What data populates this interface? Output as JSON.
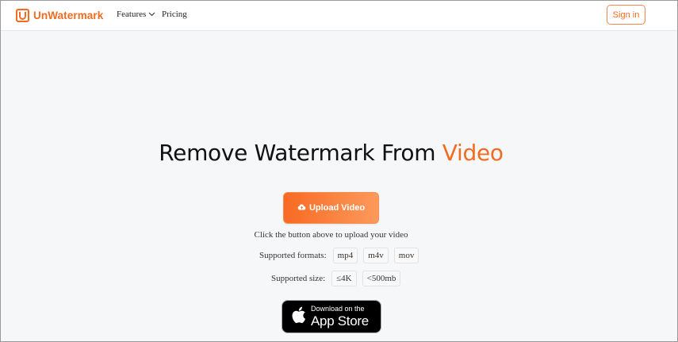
{
  "brand": {
    "name": "UnWatermark",
    "logo_letter": "U",
    "color": "#f26b21"
  },
  "nav": {
    "features": "Features",
    "pricing": "Pricing",
    "signin": "Sign in",
    "features_icon": "chevron-down-icon"
  },
  "hero": {
    "title_prefix": "Remove Watermark From ",
    "title_accent": "Video",
    "upload_label": "Upload Video",
    "upload_icon": "cloud-upload-icon",
    "hint": "Click the button above to upload your video"
  },
  "formats": {
    "label": "Supported formats:",
    "items": [
      "mp4",
      "m4v",
      "mov"
    ]
  },
  "size": {
    "label": "Supported size:",
    "items": [
      "≤4K",
      "<500mb"
    ]
  },
  "appstore": {
    "small": "Download on the",
    "big": "App Store",
    "icon": "apple-icon"
  }
}
